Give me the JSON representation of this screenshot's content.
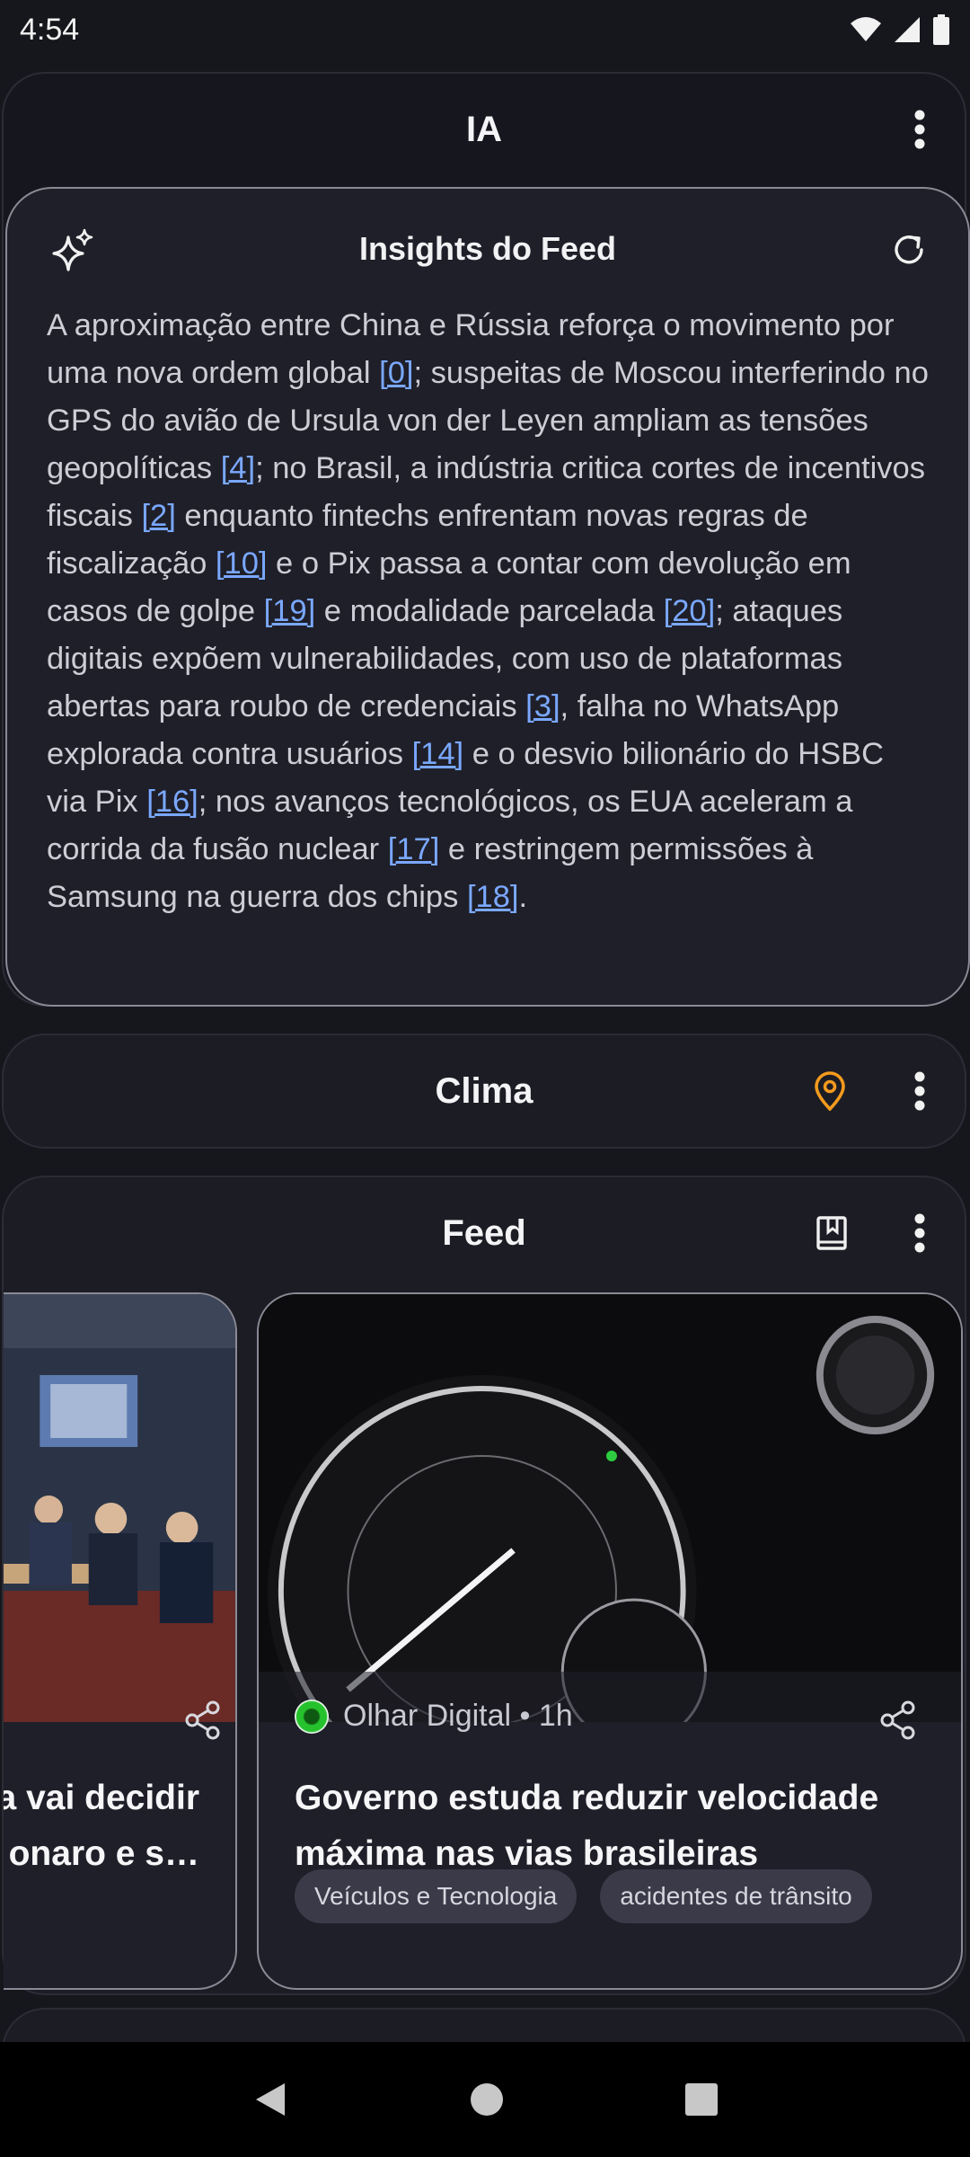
{
  "status_bar": {
    "time": "4:54"
  },
  "ia_card": {
    "title": "IA",
    "insights": {
      "title": "Insights do Feed",
      "segments": [
        {
          "t": "A aproximação entre China e Rússia reforça o movimento por uma nova ordem global "
        },
        {
          "ref": "[0]"
        },
        {
          "t": "; suspeitas de Moscou interferindo no GPS do avião de Ursula von der Leyen ampliam as tensões geopolíticas "
        },
        {
          "ref": "[4]"
        },
        {
          "t": "; no Brasil, a indústria critica cortes de incentivos fiscais "
        },
        {
          "ref": "[2]"
        },
        {
          "t": " enquanto fintechs enfrentam novas regras de fiscalização "
        },
        {
          "ref": "[10]"
        },
        {
          "t": " e o Pix passa a contar com devolução em casos de golpe "
        },
        {
          "ref": "[19]"
        },
        {
          "t": " e modalidade parcelada "
        },
        {
          "ref": "[20]"
        },
        {
          "t": "; ataques digitais expõem vulnerabilidades, com uso de plataformas abertas para roubo de credenciais "
        },
        {
          "ref": "[3]"
        },
        {
          "t": ", falha no WhatsApp explorada contra usuários "
        },
        {
          "ref": "[14]"
        },
        {
          "t": " e o desvio bilionário do HSBC via Pix "
        },
        {
          "ref": "[16]"
        },
        {
          "t": "; nos avanços tecnológicos, os EUA aceleram a corrida da fusão nuclear "
        },
        {
          "ref": "[17]"
        },
        {
          "t": " e restringem permissões à Samsung na guerra dos chips "
        },
        {
          "ref": "[18]"
        },
        {
          "t": "."
        }
      ]
    }
  },
  "clima_card": {
    "title": "Clima",
    "location_icon_color": "#f39a1e"
  },
  "feed_card": {
    "title": "Feed",
    "left_article": {
      "title_line1": "a vai decidir",
      "title_line2": "onaro e s…"
    },
    "main_article": {
      "source": "Olhar Digital • 1h",
      "title": "Governo estuda reduzir velocidade máxima nas vias brasileiras",
      "tags": [
        "Veículos e Tecnologia",
        "acidentes de trânsito"
      ]
    }
  },
  "colors": {
    "link": "#7aa8ff",
    "background": "#16161d",
    "card": "#1c1c24"
  }
}
